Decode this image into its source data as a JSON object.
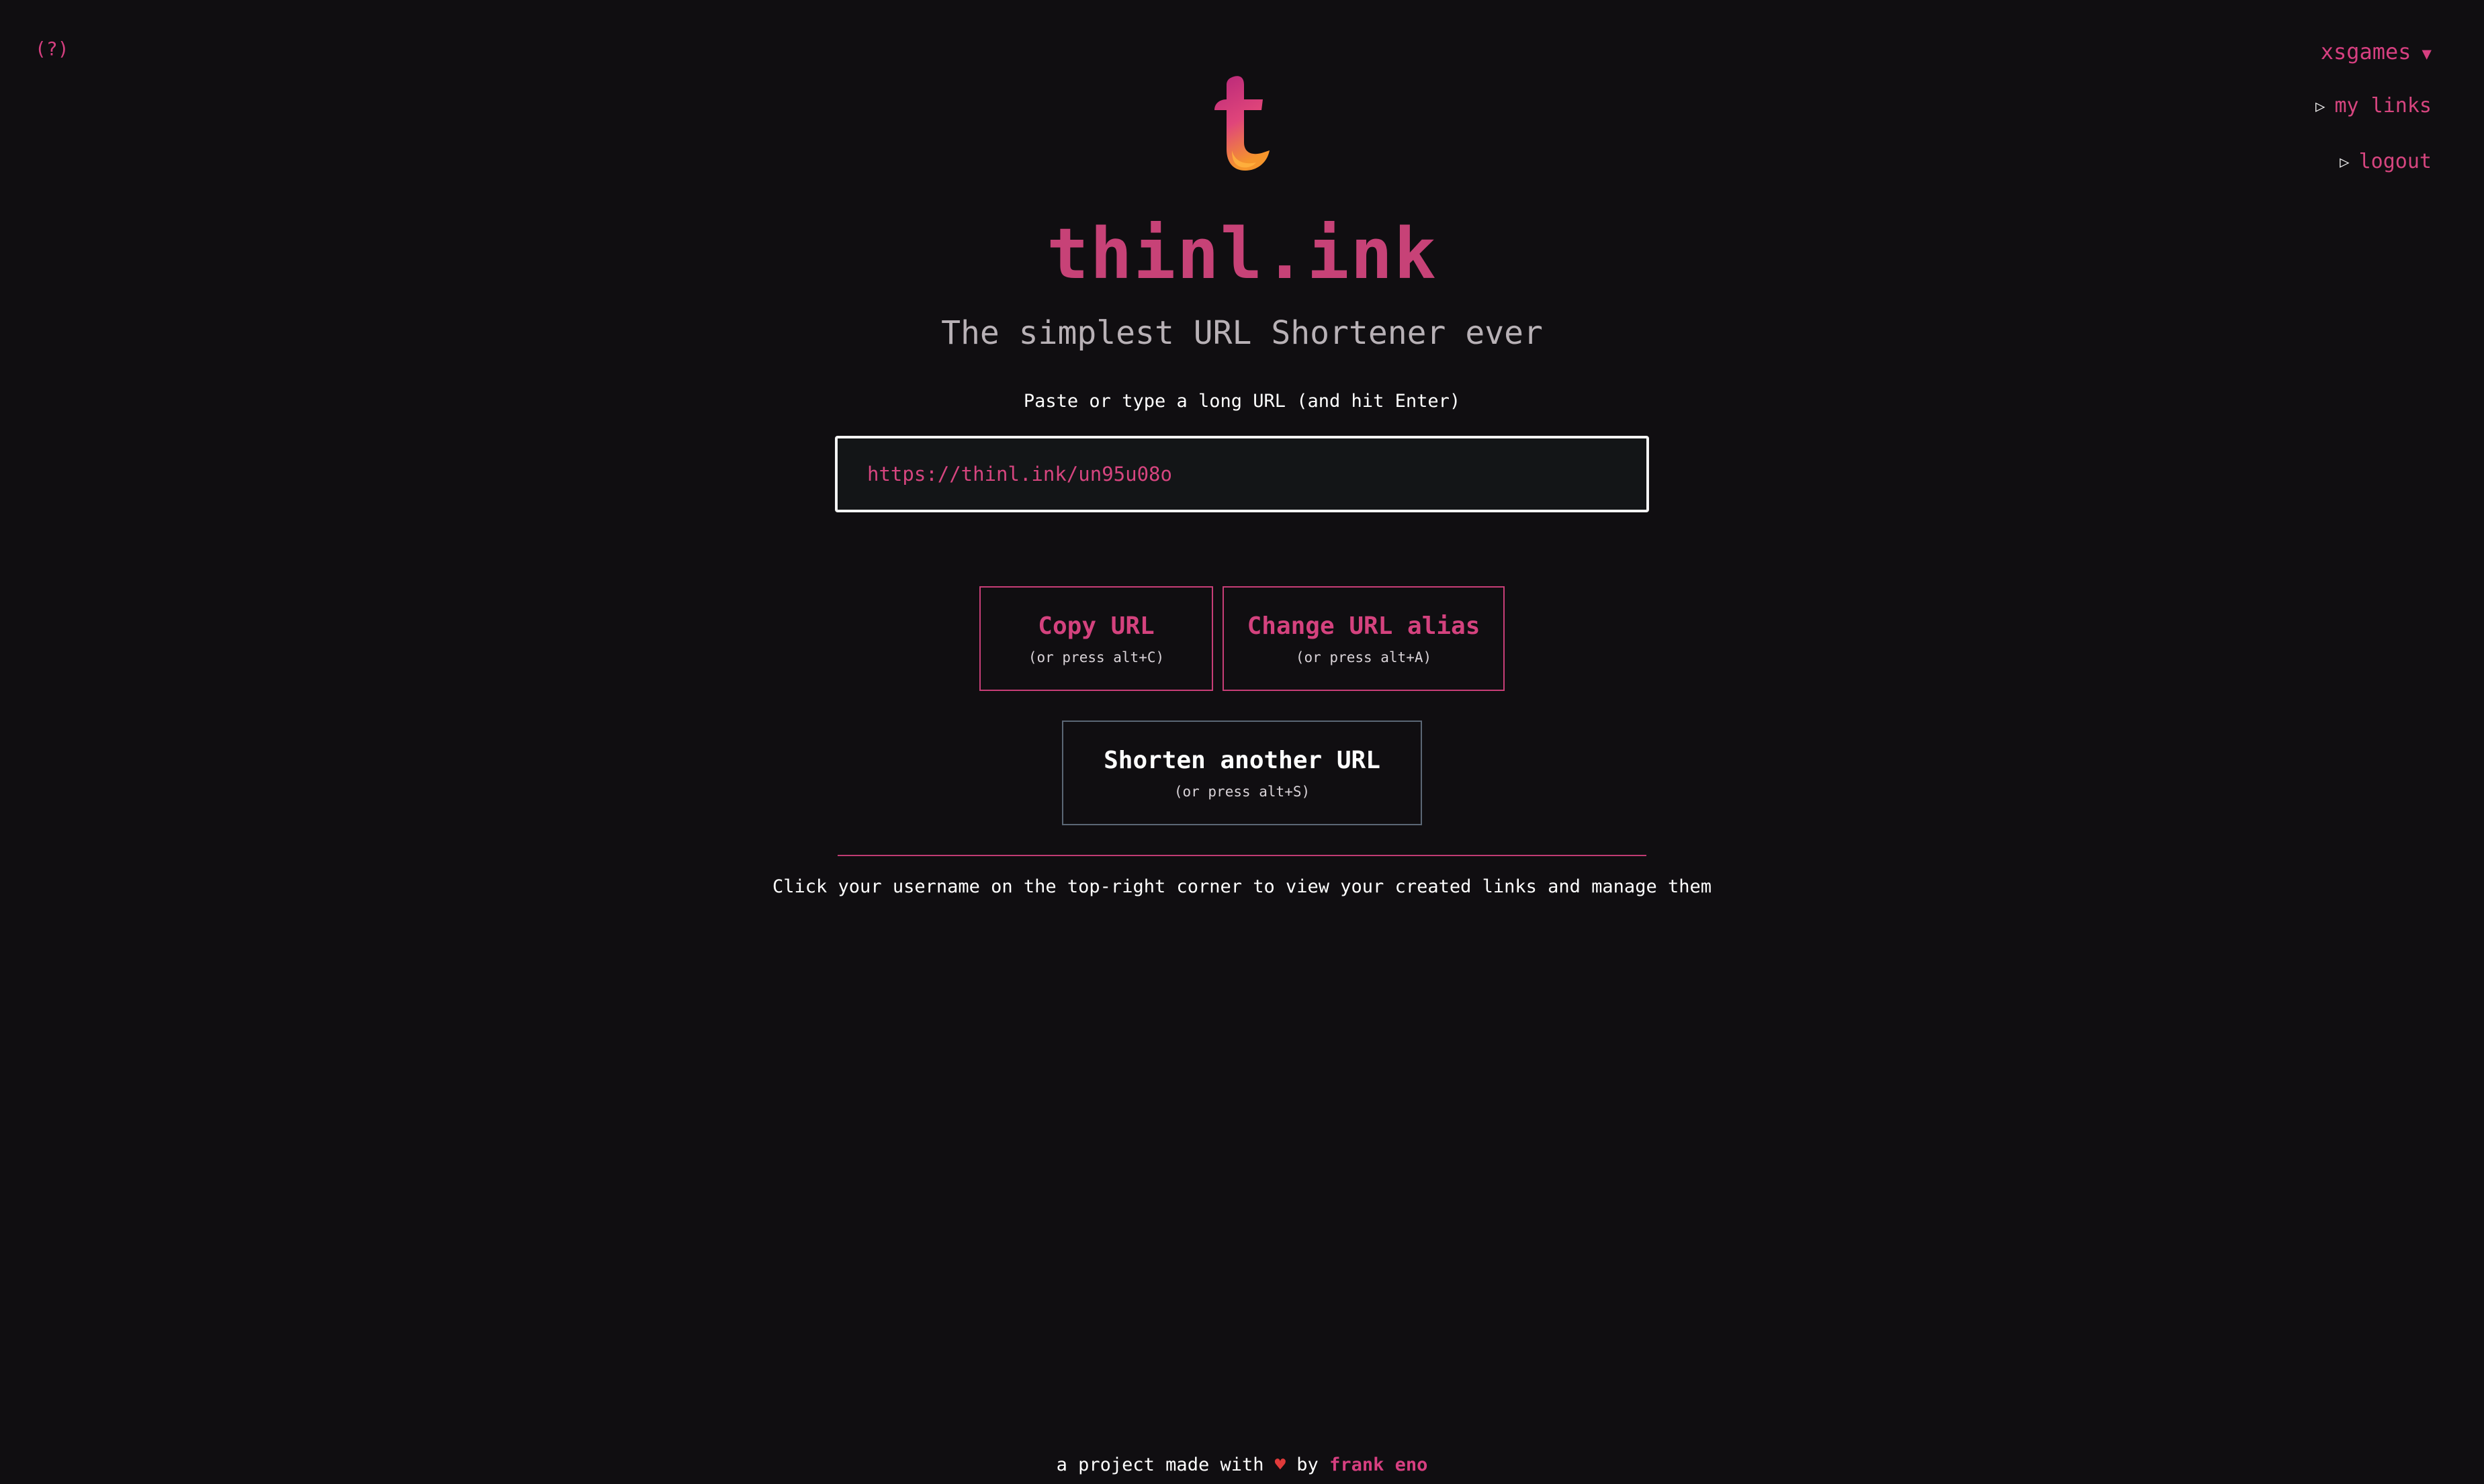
{
  "help": {
    "label": "(?)"
  },
  "user_menu": {
    "username": "xsgames",
    "caret": "▼",
    "items": [
      {
        "label": "my links"
      },
      {
        "label": "logout"
      }
    ],
    "item_marker": "▷"
  },
  "brand": {
    "title": "thinl.ink",
    "subtitle": "The simplest URL Shortener ever",
    "colors": {
      "accent": "#d63f80",
      "logo_top": "#c4307a",
      "logo_bottom": "#f28a2c"
    }
  },
  "form": {
    "label": "Paste or type a long URL (and hit Enter)",
    "value": "https://thinl.ink/un95u08o"
  },
  "actions": {
    "copy": {
      "label": "Copy URL",
      "hint": "(or press alt+C)"
    },
    "alias": {
      "label": "Change URL alias",
      "hint": "(or press alt+A)"
    },
    "another": {
      "label": "Shorten another URL",
      "hint": "(or press alt+S)"
    }
  },
  "note": "Click your username on the top-right corner to view your created links and manage them",
  "footer": {
    "prefix": "a project made with",
    "heart": "♥",
    "by": "by",
    "author": "frank eno"
  }
}
